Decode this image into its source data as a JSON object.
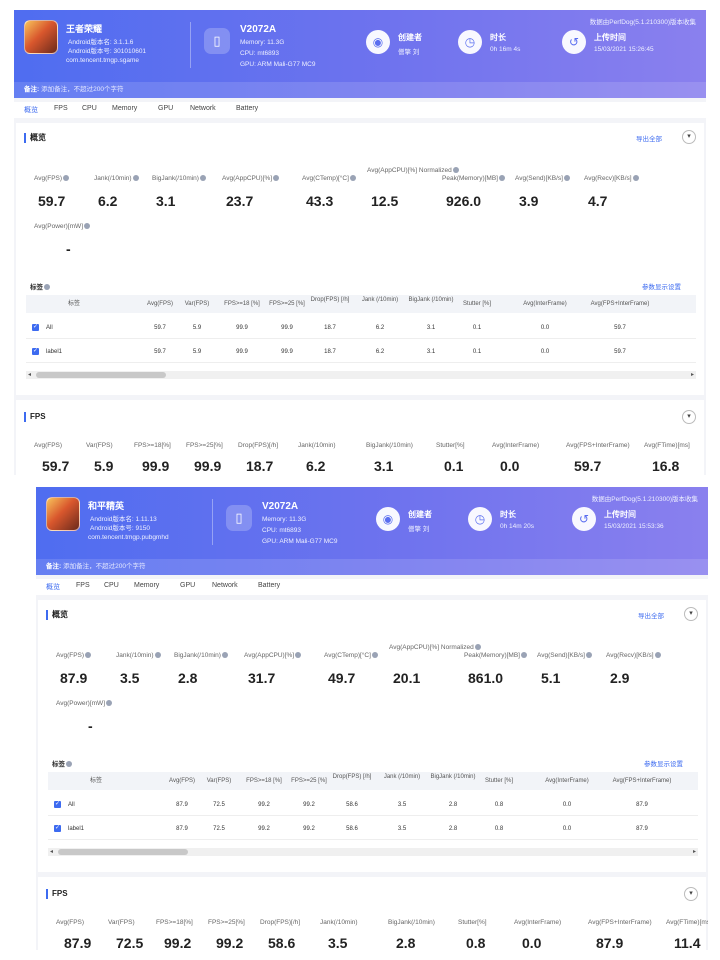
{
  "panels": [
    {
      "app": {
        "name": "王者荣耀",
        "android_version_name": "Android版本名: 3.1.1.6",
        "android_version_code": "Android版本号: 301010601",
        "package": "com.tencent.tmgp.sgame"
      },
      "device": {
        "model": "V2072A",
        "memory": "Memory: 11.3G",
        "cpu": "CPU: mt6893",
        "gpu": "GPU: ARM Mali-G77 MC9"
      },
      "creator": {
        "title": "创建者",
        "value": "僧擎 刘"
      },
      "duration": {
        "title": "时长",
        "value": "0h 16m 4s"
      },
      "upload": {
        "title": "上传时间",
        "value": "15/03/2021 15:26:45"
      },
      "version_note": "数据由PerfDog(5.1.210300)版本收集",
      "note": {
        "label": "备注:",
        "placeholder": "添加备注，不超过200个字符"
      },
      "tabs": [
        "概览",
        "FPS",
        "CPU",
        "Memory",
        "GPU",
        "Network",
        "Battery"
      ],
      "overview": {
        "title": "概览",
        "export_label": "导出全部",
        "metrics": [
          {
            "label": "Avg(FPS)",
            "value": "59.7"
          },
          {
            "label": "Jank(/10min)",
            "value": "6.2"
          },
          {
            "label": "BigJank(/10min)",
            "value": "3.1"
          },
          {
            "label": "Avg(AppCPU)[%]",
            "value": "23.7"
          },
          {
            "label": "Avg(CTemp)[°C]",
            "value": "43.3"
          },
          {
            "label": "Avg(AppCPU)[%] Normalized",
            "value": "12.5"
          },
          {
            "label": "Peak(Memory)[MB]",
            "value": "926.0"
          },
          {
            "label": "Avg(Send)[KB/s]",
            "value": "3.9"
          },
          {
            "label": "Avg(Recv)[KB/s]",
            "value": "4.7"
          }
        ],
        "power": {
          "label": "Avg(Power)[mW]",
          "value": "-"
        },
        "tag_title": "标签",
        "tag_settings": "参数显示设置",
        "table": {
          "headers": [
            "标签",
            "Avg(FPS)",
            "Var(FPS)",
            "FPS>=18 [%]",
            "FPS>=25 [%]",
            "Drop(FPS) [/h]",
            "Jank (/10min)",
            "BigJank (/10min)",
            "Stutter [%]",
            "Avg(InterFrame)",
            "Avg(FPS+InterFrame)"
          ],
          "rows": [
            [
              "All",
              "59.7",
              "5.9",
              "99.9",
              "99.9",
              "18.7",
              "6.2",
              "3.1",
              "0.1",
              "0.0",
              "59.7"
            ],
            [
              "label1",
              "59.7",
              "5.9",
              "99.9",
              "99.9",
              "18.7",
              "6.2",
              "3.1",
              "0.1",
              "0.0",
              "59.7"
            ]
          ]
        }
      },
      "fps": {
        "title": "FPS",
        "metrics": [
          {
            "label": "Avg(FPS)",
            "value": "59.7"
          },
          {
            "label": "Var(FPS)",
            "value": "5.9"
          },
          {
            "label": "FPS>=18[%]",
            "value": "99.9"
          },
          {
            "label": "FPS>=25[%]",
            "value": "99.9"
          },
          {
            "label": "Drop(FPS)[/h]",
            "value": "18.7"
          },
          {
            "label": "Jank(/10min)",
            "value": "6.2"
          },
          {
            "label": "BigJank(/10min)",
            "value": "3.1"
          },
          {
            "label": "Stutter[%]",
            "value": "0.1"
          },
          {
            "label": "Avg(InterFrame)",
            "value": "0.0"
          },
          {
            "label": "Avg(FPS+InterFrame)",
            "value": "59.7"
          },
          {
            "label": "Avg(FTime)[ms]",
            "value": "16.8"
          }
        ]
      }
    },
    {
      "app": {
        "name": "和平精英",
        "android_version_name": "Android版本名: 1.11.13",
        "android_version_code": "Android版本号: 9150",
        "package": "com.tencent.tmgp.pubgmhd"
      },
      "device": {
        "model": "V2072A",
        "memory": "Memory: 11.3G",
        "cpu": "CPU: mt6893",
        "gpu": "GPU: ARM Mali-G77 MC9"
      },
      "creator": {
        "title": "创建者",
        "value": "僧擎 刘"
      },
      "duration": {
        "title": "时长",
        "value": "0h 14m 20s"
      },
      "upload": {
        "title": "上传时间",
        "value": "15/03/2021 15:53:36"
      },
      "version_note": "数据由PerfDog(5.1.210300)版本收集",
      "note": {
        "label": "备注:",
        "placeholder": "添加备注，不超过200个字符"
      },
      "tabs": [
        "概览",
        "FPS",
        "CPU",
        "Memory",
        "GPU",
        "Network",
        "Battery"
      ],
      "overview": {
        "title": "概览",
        "export_label": "导出全部",
        "metrics": [
          {
            "label": "Avg(FPS)",
            "value": "87.9"
          },
          {
            "label": "Jank(/10min)",
            "value": "3.5"
          },
          {
            "label": "BigJank(/10min)",
            "value": "2.8"
          },
          {
            "label": "Avg(AppCPU)[%]",
            "value": "31.7"
          },
          {
            "label": "Avg(CTemp)[°C]",
            "value": "49.7"
          },
          {
            "label": "Avg(AppCPU)[%] Normalized",
            "value": "20.1"
          },
          {
            "label": "Peak(Memory)[MB]",
            "value": "861.0"
          },
          {
            "label": "Avg(Send)[KB/s]",
            "value": "5.1"
          },
          {
            "label": "Avg(Recv)[KB/s]",
            "value": "2.9"
          }
        ],
        "power": {
          "label": "Avg(Power)[mW]",
          "value": "-"
        },
        "tag_title": "标签",
        "tag_settings": "参数显示设置",
        "table": {
          "headers": [
            "标签",
            "Avg(FPS)",
            "Var(FPS)",
            "FPS>=18 [%]",
            "FPS>=25 [%]",
            "Drop(FPS) [/h]",
            "Jank (/10min)",
            "BigJank (/10min)",
            "Stutter [%]",
            "Avg(InterFrame)",
            "Avg(FPS+InterFrame)"
          ],
          "rows": [
            [
              "All",
              "87.9",
              "72.5",
              "99.2",
              "99.2",
              "58.6",
              "3.5",
              "2.8",
              "0.8",
              "0.0",
              "87.9"
            ],
            [
              "label1",
              "87.9",
              "72.5",
              "99.2",
              "99.2",
              "58.6",
              "3.5",
              "2.8",
              "0.8",
              "0.0",
              "87.9"
            ]
          ]
        }
      },
      "fps": {
        "title": "FPS",
        "metrics": [
          {
            "label": "Avg(FPS)",
            "value": "87.9"
          },
          {
            "label": "Var(FPS)",
            "value": "72.5"
          },
          {
            "label": "FPS>=18[%]",
            "value": "99.2"
          },
          {
            "label": "FPS>=25[%]",
            "value": "99.2"
          },
          {
            "label": "Drop(FPS)[/h]",
            "value": "58.6"
          },
          {
            "label": "Jank(/10min)",
            "value": "3.5"
          },
          {
            "label": "BigJank(/10min)",
            "value": "2.8"
          },
          {
            "label": "Stutter[%]",
            "value": "0.8"
          },
          {
            "label": "Avg(InterFrame)",
            "value": "0.0"
          },
          {
            "label": "Avg(FPS+InterFrame)",
            "value": "87.9"
          },
          {
            "label": "Avg(FTime)[ms]",
            "value": "11.4"
          }
        ]
      }
    }
  ]
}
